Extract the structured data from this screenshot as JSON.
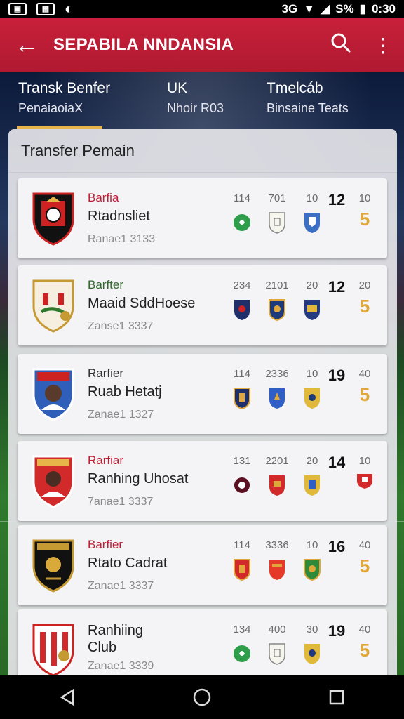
{
  "status": {
    "left_icons": [
      "gallery-icon",
      "chart-icon",
      "sync-icon"
    ],
    "network": "3G",
    "battery": "S%",
    "time": "0:30"
  },
  "app_bar": {
    "title": "SEPABILA NNDANSIA"
  },
  "tabs": [
    {
      "title": "Transk Benfer",
      "subtitle": "PenaiaoiaX"
    },
    {
      "title": "UK",
      "subtitle": "Nhoir R03"
    },
    {
      "title": "Tmelcáb",
      "subtitle": "Binsaine Teats"
    }
  ],
  "panel": {
    "title": "Transfer Pemain"
  },
  "rows": [
    {
      "label": "Barfia",
      "name": "Rtadnsliet",
      "sub": "Ranae1 3133",
      "s1": "114",
      "s2": "701",
      "s3": "10",
      "big": "12",
      "last": "10",
      "coin": "5"
    },
    {
      "label": "Barfter",
      "name": "Maaid SddHoese",
      "sub": "Zanse1 3337",
      "s1": "234",
      "s2": "2101",
      "s3": "20",
      "big": "12",
      "last": "20",
      "coin": "5"
    },
    {
      "label": "Rarfier",
      "name": "Ruab Hetatj",
      "sub": "Zanae1 1327",
      "s1": "114",
      "s2": "2336",
      "s3": "10",
      "big": "19",
      "last": "40",
      "coin": "5"
    },
    {
      "label": "Rarfiar",
      "name": "Ranhing Uhosat",
      "sub": "7anae1 3337",
      "s1": "131",
      "s2": "2201",
      "s3": "20",
      "big": "14",
      "last": "10",
      "coin": ""
    },
    {
      "label": "Barfier",
      "name": "Rtato Cadrat",
      "sub": "Zanae1 3337",
      "s1": "114",
      "s2": "3336",
      "s3": "10",
      "big": "16",
      "last": "40",
      "coin": "5"
    },
    {
      "label": "",
      "name": "Ranhiing Club",
      "sub": "Zanae1 3339",
      "s1": "134",
      "s2": "400",
      "s3": "30",
      "big": "19",
      "last": "40",
      "coin": "5"
    }
  ],
  "colors": {
    "brand": "#c01c33",
    "accent": "#e7b44a"
  }
}
